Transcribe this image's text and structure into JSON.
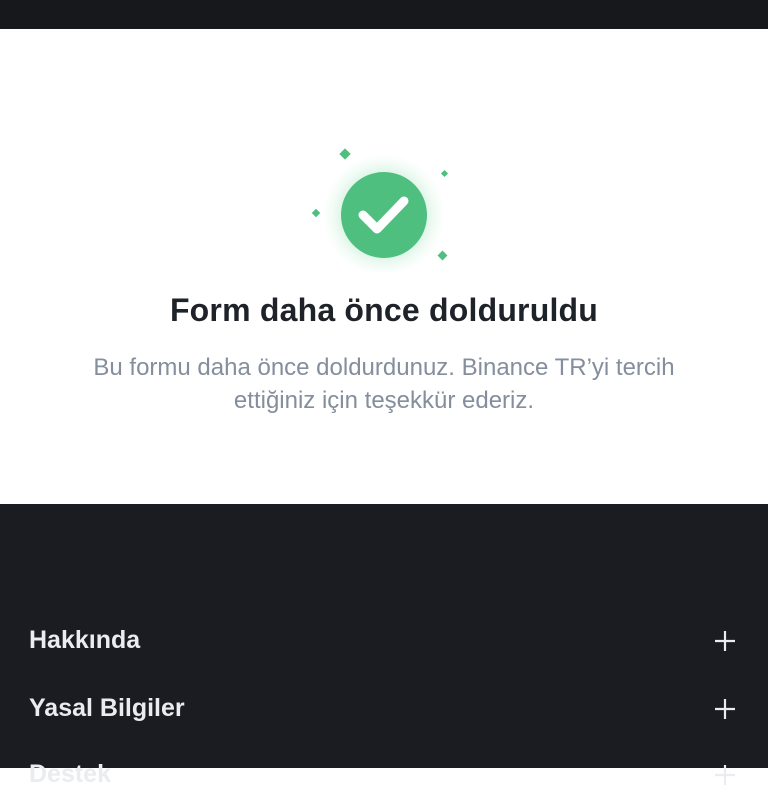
{
  "page": {
    "title": "Form daha önce dolduruldu",
    "subtitle": "Bu formu daha önce doldurdunuz. Binance TR’yi tercih ettiğiniz için teşekkür ederiz."
  },
  "icons": {
    "success": "check-circle-icon",
    "expand": "plus-icon"
  },
  "footer": {
    "items": [
      {
        "label": "Hakkında"
      },
      {
        "label": "Yasal Bilgiler"
      },
      {
        "label": "Destek"
      }
    ]
  },
  "colors": {
    "accent_green": "#4fbf7f",
    "footer_bg": "#1a1c21",
    "text_dark": "#1e2329",
    "text_muted": "#848e9c"
  }
}
